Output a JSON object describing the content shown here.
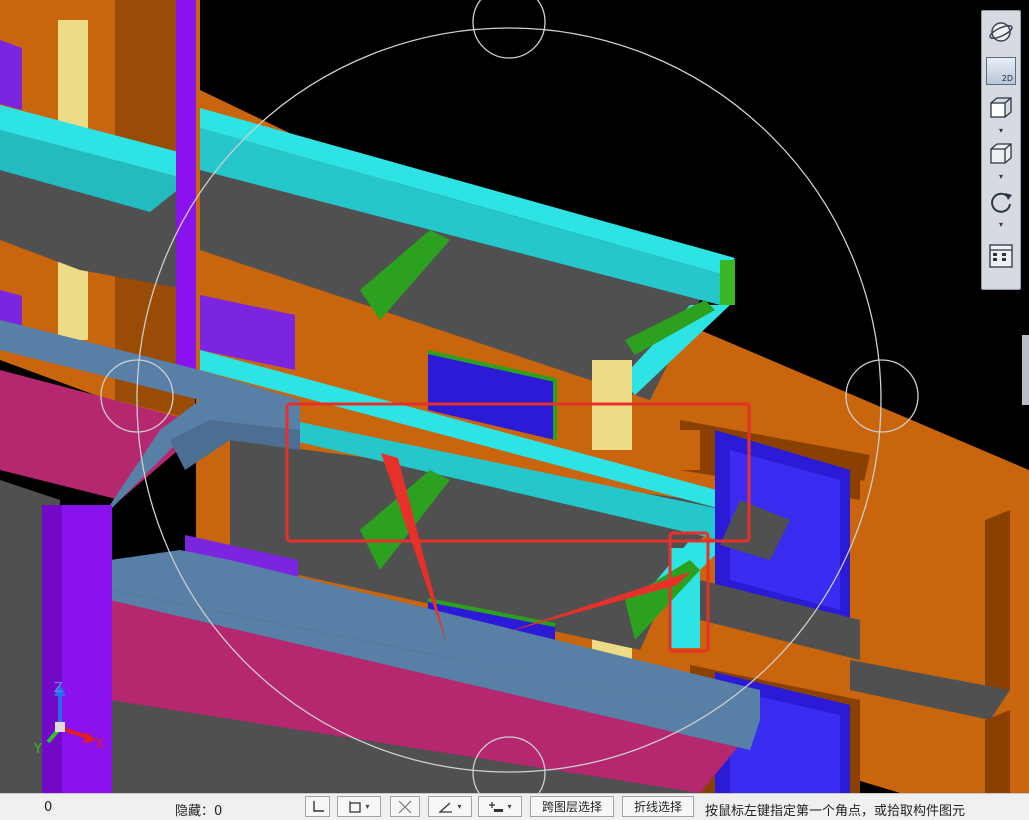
{
  "statusbar": {
    "count_value": "0",
    "hidden_label": "隐藏：0",
    "cross_layer_select": "跨图层选择",
    "polyline_select": "折线选择",
    "prompt": "按鼠标左键指定第一个角点，或拾取构件图元"
  },
  "viewbar": {
    "mode_2d_label": "2D"
  },
  "axis": {
    "x": "X",
    "y": "Y",
    "z": "Z"
  },
  "colors": {
    "beam": "#2ee3e4",
    "wall": "#c8650d",
    "column": "#8a12ee",
    "slab": "#505050",
    "window": "#2b1bd6",
    "ring_beam": "#587fa6",
    "floor_edge": "#b5276f",
    "annotation": "#e8302a"
  }
}
